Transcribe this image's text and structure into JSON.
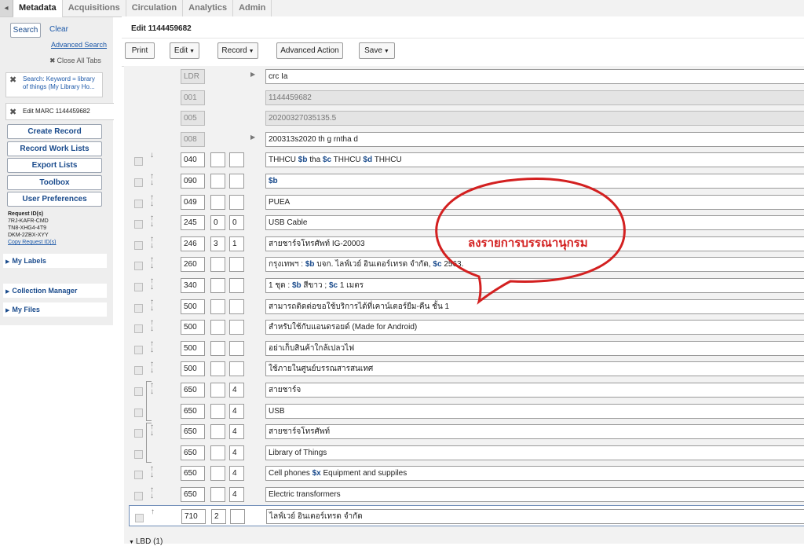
{
  "nav": {
    "collapse_icon": "◂",
    "tabs": [
      "Metadata",
      "Acquisitions",
      "Circulation",
      "Analytics",
      "Admin"
    ],
    "active_tab": "Metadata"
  },
  "sidebar": {
    "search_button": "Search",
    "clear_link": "Clear",
    "advanced_search_link": "Advanced Search",
    "close_all_tabs": "Close All Tabs",
    "search_filter": "Search: Keyword = library of things (My Library Ho...",
    "edit_tab": "Edit MARC 1144459682",
    "menu": [
      "Create Record",
      "Record Work Lists",
      "Export Lists",
      "Toolbox",
      "User Preferences"
    ],
    "request_ids_heading": "Request ID(s)",
    "request_ids": [
      "7RJ-KAFR-CMD",
      "TN8-XHG4-4T9",
      "DKM-2ZBX-XYY"
    ],
    "copy_request_ids": "Copy Request ID(s)",
    "sections": [
      "My Labels",
      "Collection Manager",
      "My Files"
    ]
  },
  "editor": {
    "title": "Edit 1144459682",
    "buttons": {
      "print": "Print",
      "edit": "Edit",
      "record": "Record",
      "advanced_action": "Advanced Action",
      "save": "Save"
    },
    "bottom_label": "LBD (1)"
  },
  "fields": [
    {
      "tag": "LDR",
      "i1": null,
      "i2": null,
      "value": "crc  Ia",
      "ro_tag": true,
      "ro_val": false,
      "expand": true
    },
    {
      "tag": "001",
      "i1": null,
      "i2": null,
      "value": "1144459682",
      "ro_tag": true,
      "ro_val": true
    },
    {
      "tag": "005",
      "i1": null,
      "i2": null,
      "value": "20200327035135.5",
      "ro_tag": true,
      "ro_val": true
    },
    {
      "tag": "008",
      "i1": null,
      "i2": null,
      "value": "200313s2020    th     g           rntha d",
      "ro_tag": true,
      "ro_val": false,
      "expand": true
    },
    {
      "tag": "040",
      "i1": "",
      "i2": "",
      "value": "THHCU $b tha $c THHCU $d THHCU",
      "arrows": "down"
    },
    {
      "tag": "090",
      "i1": "",
      "i2": "",
      "value": "$b",
      "arrows": "both"
    },
    {
      "tag": "049",
      "i1": "",
      "i2": "",
      "value": "PUEA",
      "arrows": "both"
    },
    {
      "tag": "245",
      "i1": "0",
      "i2": "0",
      "value": "USB Cable",
      "arrows": "both"
    },
    {
      "tag": "246",
      "i1": "3",
      "i2": "1",
      "value": "สายชาร์จโทรศัพท์ IG-20003",
      "arrows": "both"
    },
    {
      "tag": "260",
      "i1": "",
      "i2": "",
      "value": "กรุงเทพฯ : $b บจก. ไลฟ์เวย์ อินเตอร์เทรด จำกัด, $c 2563.",
      "arrows": "both"
    },
    {
      "tag": "340",
      "i1": "",
      "i2": "",
      "value": "1 ชุด : $b สีขาว ; $c 1 เมตร",
      "arrows": "both"
    },
    {
      "tag": "500",
      "i1": "",
      "i2": "",
      "value": "สามารถติดต่อขอใช้บริการได้ที่เคาน์เตอร์ยืม-คืน ชั้น 1",
      "arrows": "both"
    },
    {
      "tag": "500",
      "i1": "",
      "i2": "",
      "value": "สำหรับใช้กับแอนดรอยด์ (Made for Android)",
      "arrows": "both"
    },
    {
      "tag": "500",
      "i1": "",
      "i2": "",
      "value": "อย่าเก็บสินค้าใกล้เปลวไฟ",
      "arrows": "both"
    },
    {
      "tag": "500",
      "i1": "",
      "i2": "",
      "value": "ใช้ภายในศูนย์บรรณสารสนเทศ",
      "arrows": "both"
    },
    {
      "tag": "650",
      "i1": "",
      "i2": "4",
      "value": "สายชาร์จ",
      "arrows": "both",
      "group_start": true
    },
    {
      "tag": "650",
      "i1": "",
      "i2": "4",
      "value": "USB",
      "arrows": "none",
      "group_end": true
    },
    {
      "tag": "650",
      "i1": "",
      "i2": "4",
      "value": "สายชาร์จโทรศัพท์",
      "arrows": "both",
      "group_start": true
    },
    {
      "tag": "650",
      "i1": "",
      "i2": "4",
      "value": "Library of Things",
      "arrows": "none",
      "group_end": true
    },
    {
      "tag": "650",
      "i1": "",
      "i2": "4",
      "value": "Cell phones $x Equipment and suppiles",
      "arrows": "both"
    },
    {
      "tag": "650",
      "i1": "",
      "i2": "4",
      "value": "Electric transformers",
      "arrows": "both"
    },
    {
      "tag": "710",
      "i1": "2",
      "i2": "",
      "value": "ไลฟ์เวย์ อินเตอร์เทรด จำกัด",
      "arrows": "up",
      "selected": true
    }
  ],
  "callout": {
    "text": "ลงรายการบรรณานุกรม",
    "color": "#d32020"
  }
}
